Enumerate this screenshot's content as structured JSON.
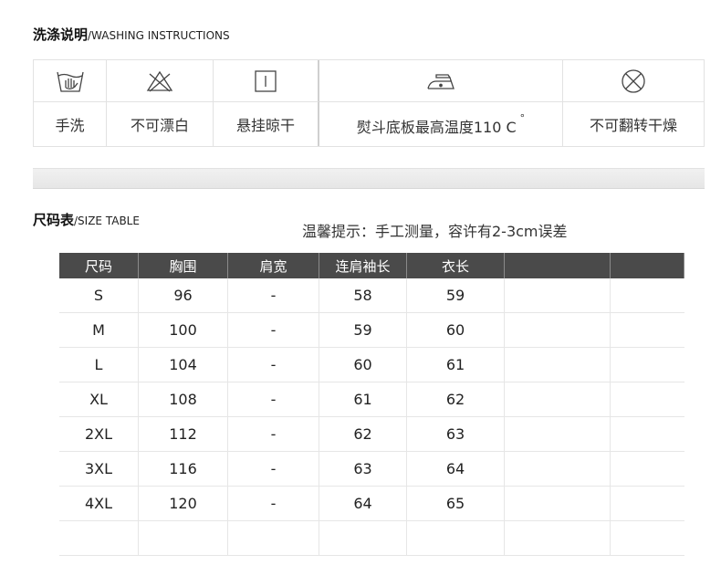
{
  "wash": {
    "title_cn": "洗涤说明",
    "title_en": "/WASHING INSTRUCTIONS",
    "items": [
      {
        "icon": "hand-wash-icon",
        "label": "手洗"
      },
      {
        "icon": "no-bleach-icon",
        "label": "不可漂白"
      },
      {
        "icon": "hang-dry-icon",
        "label": "悬挂晾干"
      },
      {
        "icon": "iron-icon",
        "label": "熨斗底板最高温度110 C",
        "sup": "°"
      },
      {
        "icon": "no-tumble-dry-icon",
        "label": "不可翻转干燥"
      }
    ]
  },
  "size": {
    "title_cn": "尺码表",
    "title_en": "/SIZE TABLE",
    "tip": "温馨提示：手工测量，容许有2-3cm误差",
    "headers": [
      "尺码",
      "胸围",
      "肩宽",
      "连肩袖长",
      "衣长",
      "",
      ""
    ],
    "rows": [
      [
        "S",
        "96",
        "-",
        "58",
        "59",
        "",
        ""
      ],
      [
        "M",
        "100",
        "-",
        "59",
        "60",
        "",
        ""
      ],
      [
        "L",
        "104",
        "-",
        "60",
        "61",
        "",
        ""
      ],
      [
        "XL",
        "108",
        "-",
        "61",
        "62",
        "",
        ""
      ],
      [
        "2XL",
        "112",
        "-",
        "62",
        "63",
        "",
        ""
      ],
      [
        "3XL",
        "116",
        "-",
        "63",
        "64",
        "",
        ""
      ],
      [
        "4XL",
        "120",
        "-",
        "64",
        "65",
        "",
        ""
      ],
      [
        "",
        "",
        "",
        "",
        "",
        "",
        ""
      ]
    ]
  },
  "colors": {
    "header_bg": "#4a4a4a",
    "header_text": "#ffffff",
    "grid_line": "#e6e6e6",
    "text": "#333333"
  }
}
